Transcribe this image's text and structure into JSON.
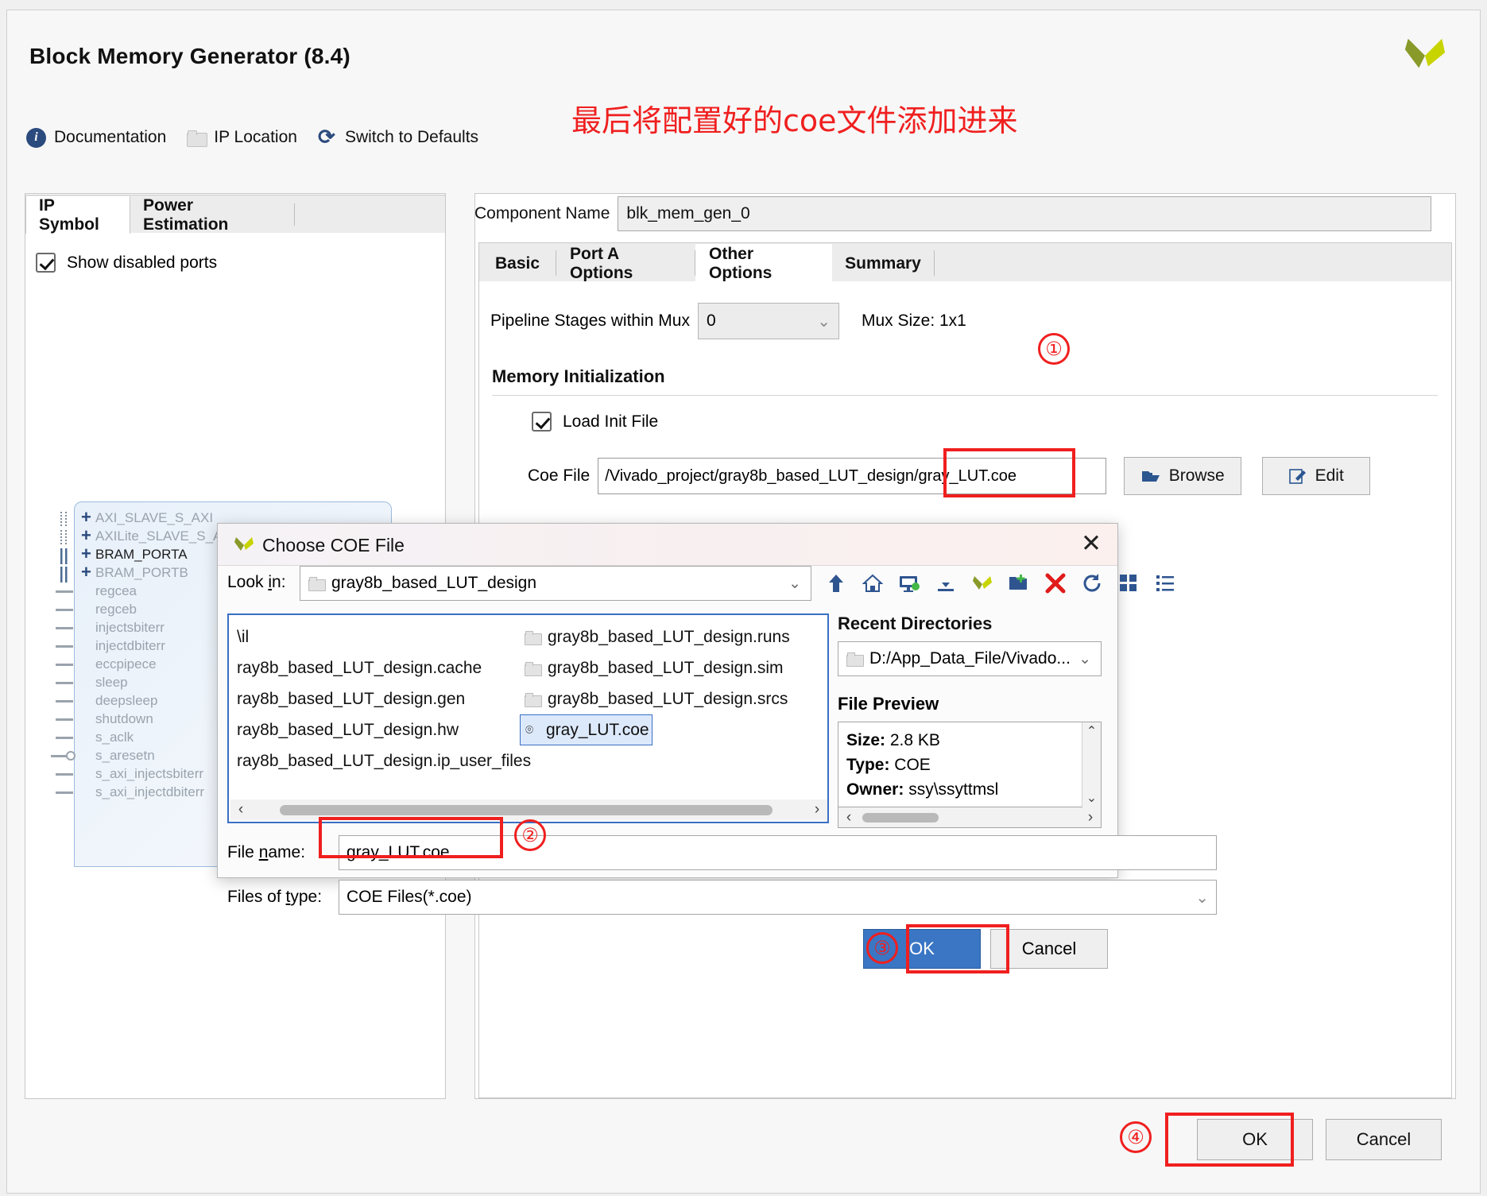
{
  "window": {
    "title": "Block Memory Generator (8.4)",
    "logo_icon": "vivado-logo-icon"
  },
  "toolbar": {
    "documentation": "Documentation",
    "ip_location": "IP Location",
    "switch_defaults": "Switch to Defaults",
    "info_icon": "info-icon",
    "folder_icon": "folder-icon",
    "refresh_icon": "refresh-icon"
  },
  "annotation": {
    "note": "最后将配置好的coe文件添加进来",
    "color": "#f01f1f",
    "markers": [
      "①",
      "②",
      "③",
      "④"
    ]
  },
  "left_panel": {
    "tabs": [
      {
        "label": "IP Symbol",
        "selected": true
      },
      {
        "label": "Power Estimation",
        "selected": false
      }
    ],
    "show_disabled_ports": {
      "label": "Show disabled ports",
      "checked": true
    },
    "ip_symbol_ports": [
      {
        "label": "AXI_SLAVE_S_AXI",
        "type": "bus-dotted",
        "expandable": true,
        "enabled": false
      },
      {
        "label": "AXILite_SLAVE_S_AXI",
        "type": "bus-dotted",
        "expandable": true,
        "enabled": false
      },
      {
        "label": "BRAM_PORTA",
        "type": "bus-solid",
        "expandable": true,
        "enabled": true
      },
      {
        "label": "BRAM_PORTB",
        "type": "bus-solid",
        "expandable": true,
        "enabled": false
      },
      {
        "label": "regcea",
        "type": "pin",
        "expandable": false,
        "enabled": false
      },
      {
        "label": "regceb",
        "type": "pin",
        "expandable": false,
        "enabled": false
      },
      {
        "label": "injectsbiterr",
        "type": "pin",
        "expandable": false,
        "enabled": false
      },
      {
        "label": "injectdbiterr",
        "type": "pin",
        "expandable": false,
        "enabled": false
      },
      {
        "label": "eccpipece",
        "type": "pin",
        "expandable": false,
        "enabled": false
      },
      {
        "label": "sleep",
        "type": "pin",
        "expandable": false,
        "enabled": false
      },
      {
        "label": "deepsleep",
        "type": "pin",
        "expandable": false,
        "enabled": false
      },
      {
        "label": "shutdown",
        "type": "pin",
        "expandable": false,
        "enabled": false
      },
      {
        "label": "s_aclk",
        "type": "pin",
        "expandable": false,
        "enabled": false
      },
      {
        "label": "s_aresetn",
        "type": "pin-inverted",
        "expandable": false,
        "enabled": false
      },
      {
        "label": "s_axi_injectsbiterr",
        "type": "pin",
        "expandable": false,
        "enabled": false
      },
      {
        "label": "s_axi_injectdbiterr",
        "type": "pin",
        "expandable": false,
        "enabled": false
      }
    ]
  },
  "right_panel": {
    "component_name_label": "Component Name",
    "component_name_value": "blk_mem_gen_0",
    "tabs": [
      {
        "label": "Basic",
        "selected": false
      },
      {
        "label": "Port A Options",
        "selected": false
      },
      {
        "label": "Other Options",
        "selected": true
      },
      {
        "label": "Summary",
        "selected": false
      }
    ],
    "pipeline_label": "Pipeline Stages within Mux",
    "pipeline_value": "0",
    "mux_size": "Mux Size: 1x1",
    "memory_init_title": "Memory Initialization",
    "load_init_file": {
      "label": "Load Init File",
      "checked": true
    },
    "coe_file_label": "Coe File",
    "coe_file_value": "/Vivado_project/gray8b_based_LUT_design/gray_LUT.coe",
    "browse_button": "Browse",
    "edit_button": "Edit",
    "browse_icon": "folder-open-icon",
    "edit_icon": "pencil-edit-icon"
  },
  "dialog": {
    "title": "Choose COE File",
    "close_icon": "close-icon",
    "look_in_label": "Look in:",
    "look_in_value": "gray8b_based_LUT_design",
    "toolbar_icons": [
      "up-arrow-icon",
      "home-icon",
      "desktop-icon",
      "download-icon",
      "vivado-icon",
      "new-folder-icon",
      "delete-icon",
      "refresh-icon",
      "grid-view-icon",
      "list-view-icon"
    ],
    "file_list_left": [
      "\\il",
      "ray8b_based_LUT_design.cache",
      "ray8b_based_LUT_design.gen",
      "ray8b_based_LUT_design.hw",
      "ray8b_based_LUT_design.ip_user_files"
    ],
    "file_list_right": [
      {
        "label": "gray8b_based_LUT_design.runs",
        "type": "folder",
        "selected": false
      },
      {
        "label": "gray8b_based_LUT_design.sim",
        "type": "folder",
        "selected": false
      },
      {
        "label": "gray8b_based_LUT_design.srcs",
        "type": "folder",
        "selected": false
      },
      {
        "label": "gray_LUT.coe",
        "type": "file",
        "selected": true
      }
    ],
    "recent_directories_title": "Recent Directories",
    "recent_directories_value": "D:/App_Data_File/Vivado...",
    "file_preview_title": "File Preview",
    "preview": {
      "size_label": "Size:",
      "size_value": "2.8 KB",
      "type_label": "Type:",
      "type_value": "COE",
      "owner_label": "Owner:",
      "owner_value": "ssy\\ssyttmsl"
    },
    "file_name_label": "File name:",
    "file_name_value": "gray_LUT.coe",
    "files_of_type_label": "Files of type:",
    "files_of_type_value": "COE Files(*.coe)",
    "ok_button": "OK",
    "cancel_button": "Cancel"
  },
  "footer": {
    "ok_button": "OK",
    "cancel_button": "Cancel"
  }
}
